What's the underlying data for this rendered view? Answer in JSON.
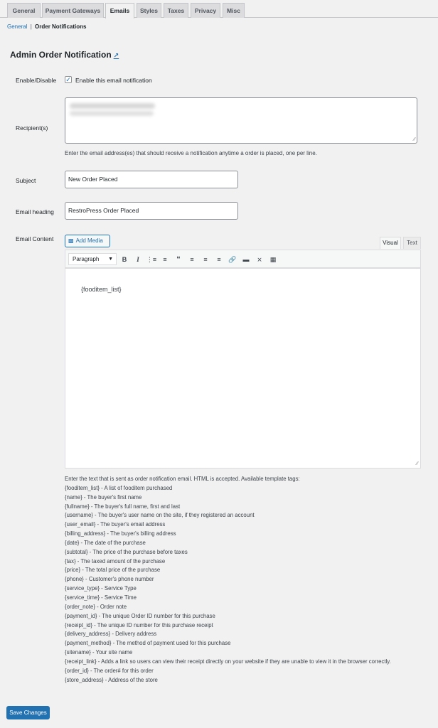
{
  "tabs": [
    "General",
    "Payment Gateways",
    "Emails",
    "Styles",
    "Taxes",
    "Privacy",
    "Misc"
  ],
  "active_tab": "Emails",
  "subnav": {
    "general": "General",
    "separator": "|",
    "current": "Order Notifications"
  },
  "section_title": "Admin Order Notification",
  "fields": {
    "enable": {
      "label": "Enable/Disable",
      "checkbox_label": "Enable this email notification",
      "checked": true
    },
    "recipients": {
      "label": "Recipient(s)",
      "description": "Enter the email address(es) that should receive a notification anytime a order is placed, one per line."
    },
    "subject": {
      "label": "Subject",
      "value": "New Order Placed"
    },
    "email_heading": {
      "label": "Email heading",
      "value": "RestroPress Order Placed"
    },
    "email_content": {
      "label": "Email Content"
    }
  },
  "editor": {
    "add_media": "Add Media",
    "visual_tab": "Visual",
    "text_tab": "Text",
    "format": "Paragraph",
    "content": "{fooditem_list}",
    "toolbar_icons": [
      "bold-icon",
      "italic-icon",
      "bullet-list-icon",
      "numbered-list-icon",
      "blockquote-icon",
      "align-left-icon",
      "align-center-icon",
      "align-right-icon",
      "link-icon",
      "read-more-icon",
      "fullscreen-icon",
      "toolbar-toggle-icon"
    ]
  },
  "tags_intro": "Enter the text that is sent as order notification email. HTML is accepted. Available template tags:",
  "template_tags": [
    "{fooditem_list} - A list of fooditem purchased",
    "{name} - The buyer's first name",
    "{fullname} - The buyer's full name, first and last",
    "{username} - The buyer's user name on the site, if they registered an account",
    "{user_email} - The buyer's email address",
    "{billing_address} - The buyer's billing address",
    "{date} - The date of the purchase",
    "{subtotal} - The price of the purchase before taxes",
    "{tax} - The taxed amount of the purchase",
    "{price} - The total price of the purchase",
    "{phone} - Customer's phone number",
    "{service_type} - Service Type",
    "{service_time} - Service Time",
    "{order_note} - Order note",
    "{payment_id} - The unique Order ID number for this purchase",
    "{receipt_id} - The unique ID number for this purchase receipt",
    "{delivery_address} - Delivery address",
    "{payment_method} - The method of payment used for this purchase",
    "{sitename} - Your site name",
    "{receipt_link} - Adds a link so users can view their receipt directly on your website if they are unable to view it in the browser correctly.",
    "{order_id} - The order# for this order",
    "{store_address} - Address of the store"
  ],
  "save_button": "Save Changes",
  "colors": {
    "accent": "#2271b1",
    "background": "#f1f1f1"
  }
}
